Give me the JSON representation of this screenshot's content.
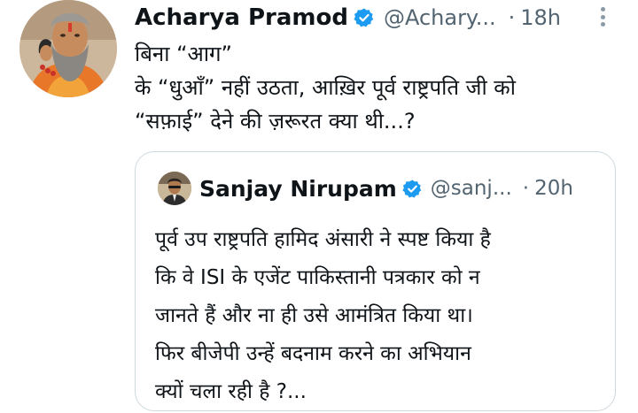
{
  "tweet": {
    "author_name": "Acharya Pramod",
    "handle": "@Achary...",
    "separator": "·",
    "time": "18h",
    "text_lines": [
      "बिना “आग”",
      "के “धुआँ” नहीं उठता, आख़िर पूर्व राष्ट्रपति जी को",
      "“सफ़ाई” देने की ज़रूरत क्या थी...?"
    ],
    "icons": {
      "verified": "verified-badge-icon",
      "more": "more-options-icon"
    }
  },
  "quoted": {
    "author_name": "Sanjay Nirupam",
    "handle": "@sanj...",
    "separator": "·",
    "time": "20h",
    "text_lines": [
      "पूर्व उप राष्ट्रपति हामिद अंसारी ने स्पष्ट किया है",
      "कि वे ISI के एजेंट पाकिस्तानी पत्रकार को न",
      "जानते हैं और ना ही उसे आमंत्रित किया था।",
      "फिर बीजेपी उन्हें बदनाम करने का अभियान",
      "क्यों चला रही है ?..."
    ]
  },
  "colors": {
    "verified_blue": "#1d9bf0",
    "secondary_text": "#536471",
    "primary_text": "#0f1419",
    "border": "#cfd9de"
  }
}
